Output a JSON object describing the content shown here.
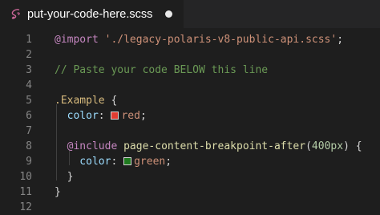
{
  "tab": {
    "title": "put-your-code-here.scss",
    "icon": "sass-icon",
    "icon_color": "#cd6799",
    "modified": true
  },
  "lines": [
    {
      "n": "1",
      "tokens": [
        {
          "t": "@import",
          "c": "at"
        },
        {
          "t": " ",
          "c": "plain"
        },
        {
          "t": "'./legacy-polaris-v8-public-api.scss'",
          "c": "str"
        },
        {
          "t": ";",
          "c": "punc"
        }
      ]
    },
    {
      "n": "2",
      "tokens": []
    },
    {
      "n": "3",
      "tokens": [
        {
          "t": "// Paste your code BELOW this line",
          "c": "comment"
        }
      ]
    },
    {
      "n": "4",
      "tokens": []
    },
    {
      "n": "5",
      "tokens": [
        {
          "t": ".Example",
          "c": "sel"
        },
        {
          "t": " {",
          "c": "punc"
        }
      ]
    },
    {
      "n": "6",
      "tokens": [
        {
          "t": "  color",
          "c": "prop"
        },
        {
          "t": ": ",
          "c": "punc"
        },
        {
          "swatch": "#e03c31"
        },
        {
          "t": "red",
          "c": "val"
        },
        {
          "t": ";",
          "c": "punc"
        }
      ]
    },
    {
      "n": "7",
      "tokens": []
    },
    {
      "n": "8",
      "tokens": [
        {
          "t": "  @include",
          "c": "at"
        },
        {
          "t": " ",
          "c": "plain"
        },
        {
          "t": "page-content-breakpoint-after",
          "c": "fn"
        },
        {
          "t": "(",
          "c": "punc"
        },
        {
          "t": "400px",
          "c": "num"
        },
        {
          "t": ")",
          "c": "punc"
        },
        {
          "t": " {",
          "c": "punc"
        }
      ]
    },
    {
      "n": "9",
      "tokens": [
        {
          "t": "    color",
          "c": "prop"
        },
        {
          "t": ": ",
          "c": "punc"
        },
        {
          "swatch": "#1f7a1f"
        },
        {
          "t": "green",
          "c": "val"
        },
        {
          "t": ";",
          "c": "punc"
        }
      ]
    },
    {
      "n": "10",
      "tokens": [
        {
          "t": "  }",
          "c": "punc"
        }
      ]
    },
    {
      "n": "11",
      "tokens": [
        {
          "t": "}",
          "c": "punc"
        }
      ]
    },
    {
      "n": "12",
      "tokens": []
    }
  ]
}
